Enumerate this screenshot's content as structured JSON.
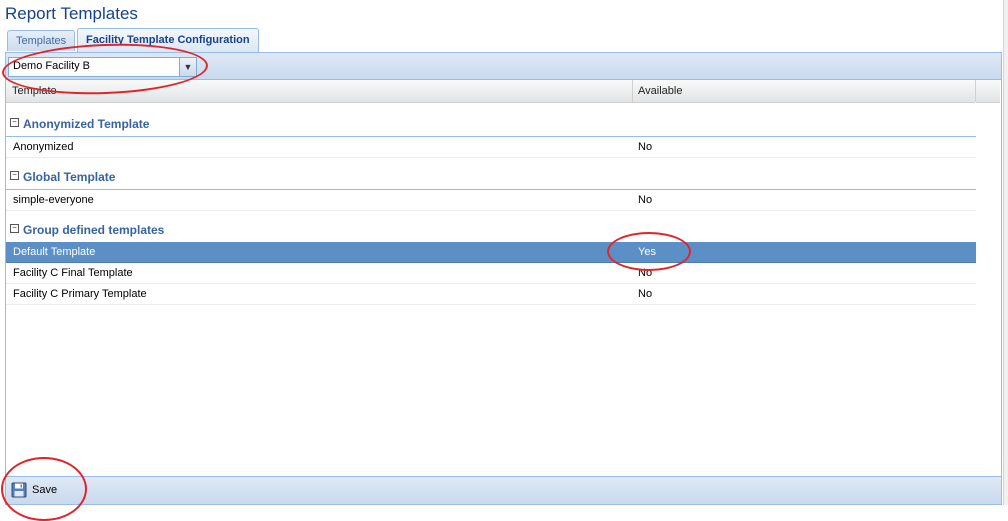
{
  "page": {
    "title": "Report Templates"
  },
  "tabs": [
    {
      "label": "Templates",
      "active": false
    },
    {
      "label": "Facility Template Configuration",
      "active": true
    }
  ],
  "toolbar": {
    "facility_select": {
      "value": "Demo Facility B"
    }
  },
  "grid": {
    "columns": [
      "Template",
      "Available"
    ],
    "groups": [
      {
        "label": "Anonymized Template",
        "rows": [
          {
            "template": "Anonymized",
            "available": "No"
          }
        ]
      },
      {
        "label": "Global Template",
        "rows": [
          {
            "template": "simple-everyone",
            "available": "No"
          }
        ]
      },
      {
        "label": "Group defined templates",
        "rows": [
          {
            "template": "Default Template",
            "available": "Yes",
            "selected": true
          },
          {
            "template": "Facility C Final Template",
            "available": "No"
          },
          {
            "template": "Facility C Primary Template",
            "available": "No"
          }
        ]
      }
    ]
  },
  "footer": {
    "save_label": "Save"
  },
  "colors": {
    "accent": "#15428b",
    "selected_row": "#5b8fc5",
    "annotation": "#e0252a"
  }
}
